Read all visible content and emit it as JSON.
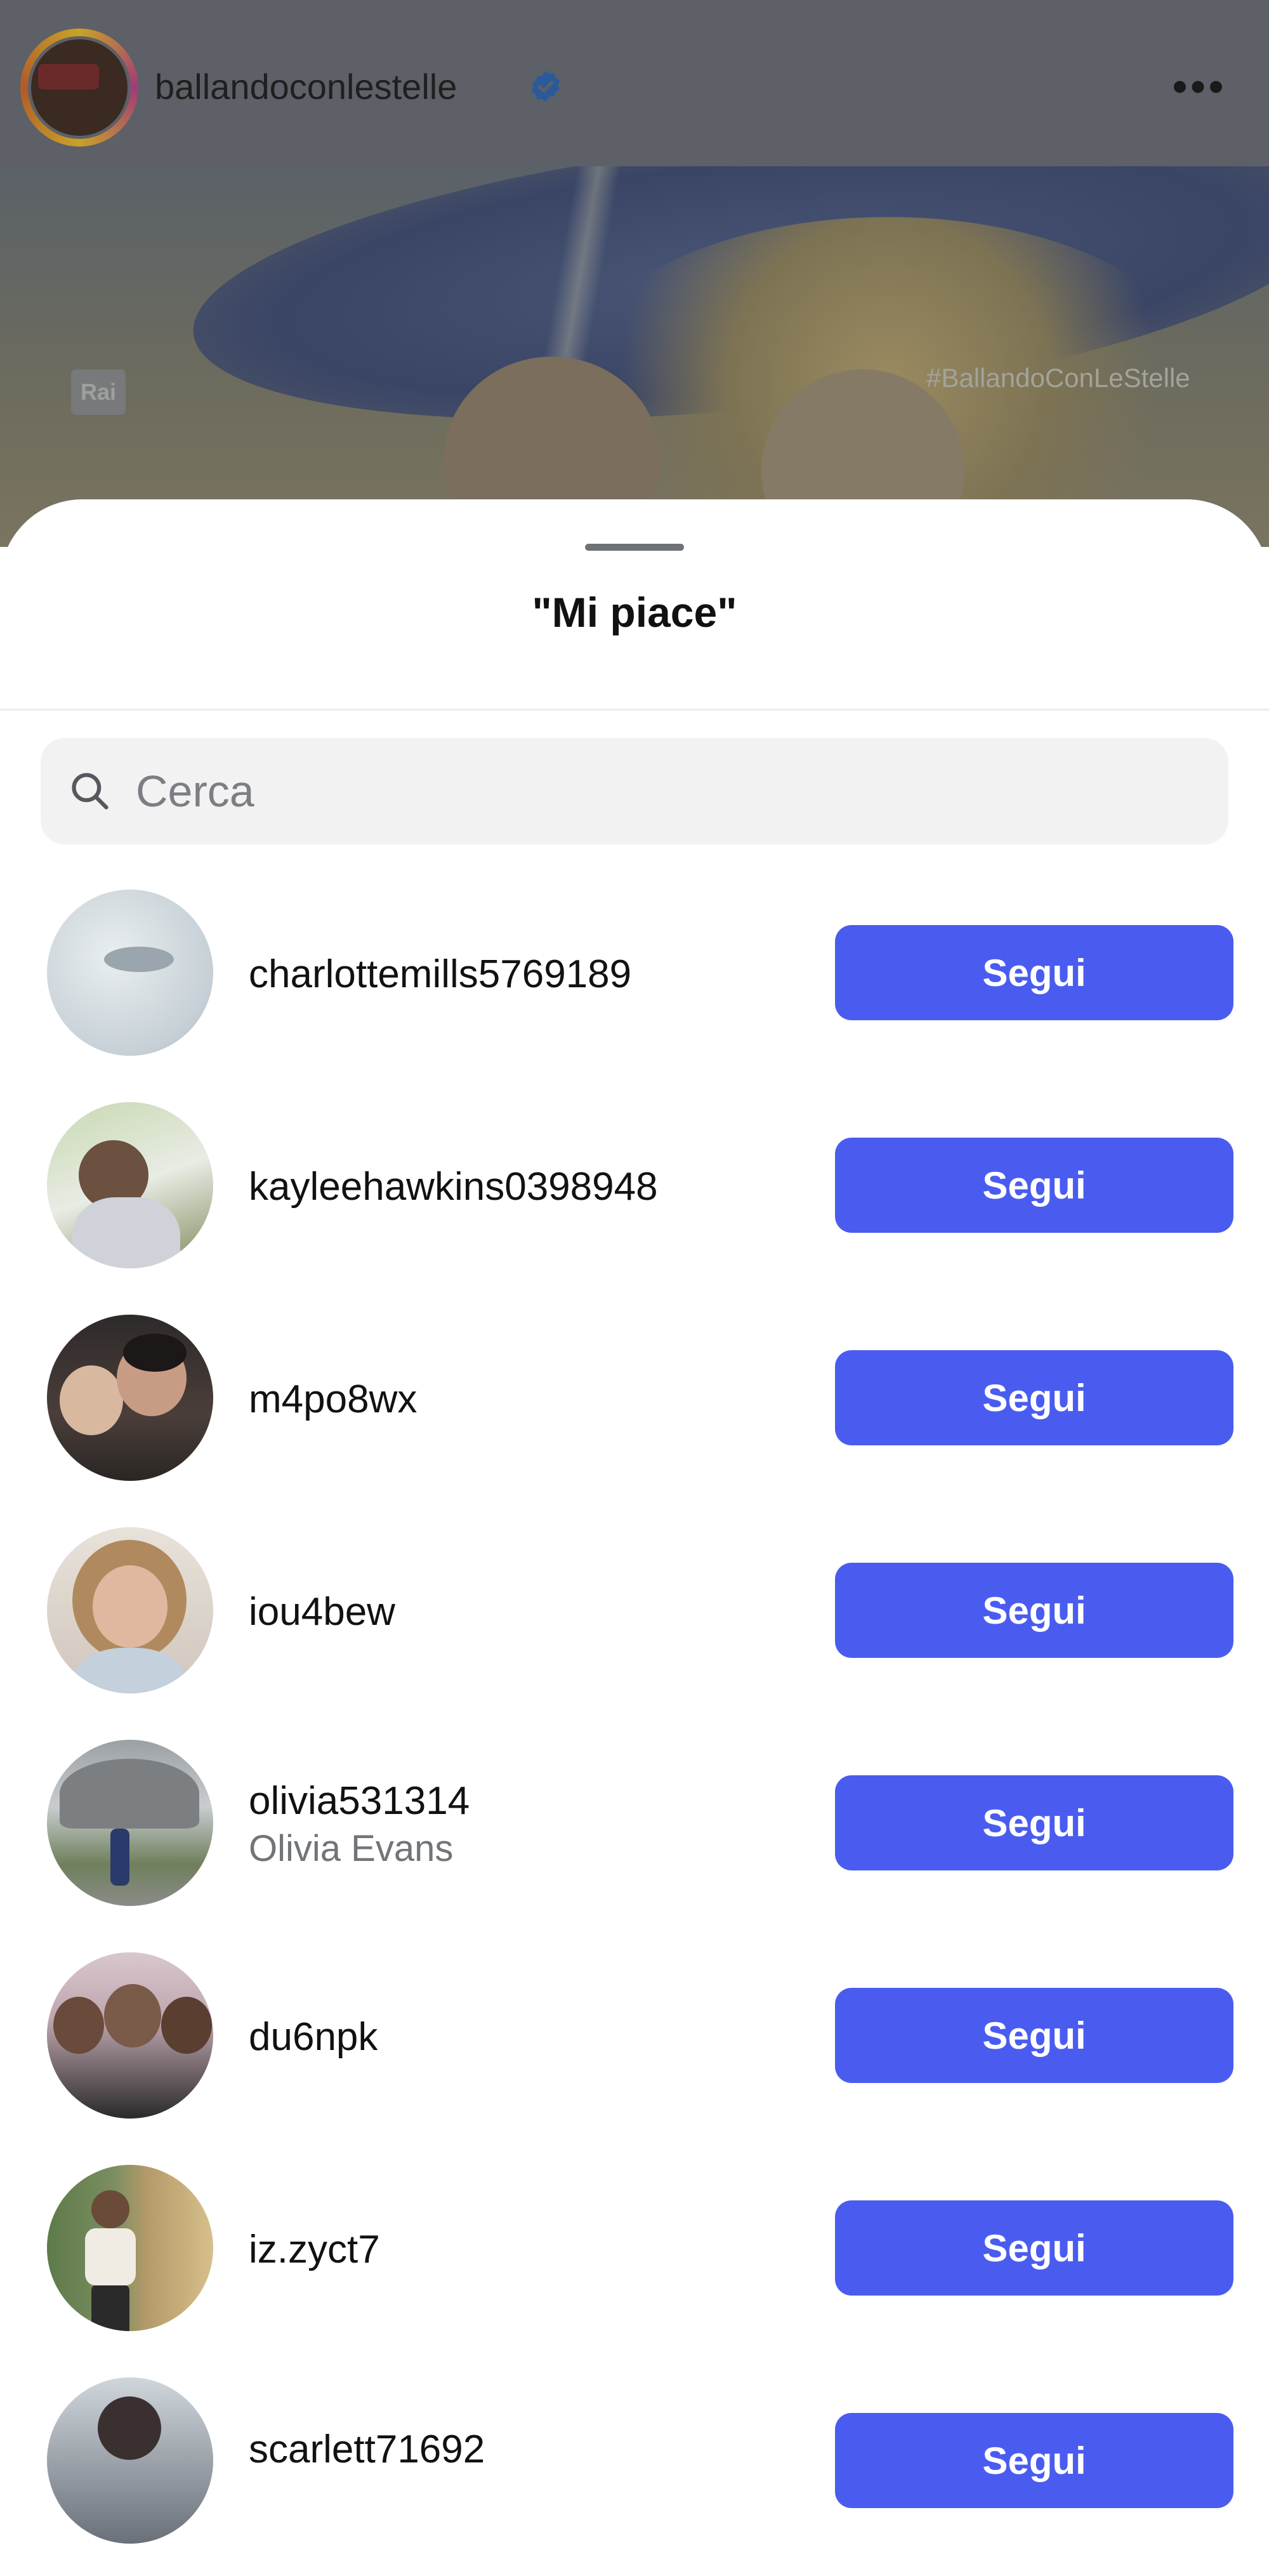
{
  "post": {
    "account_name": "ballandoconlestelle",
    "verified_icon": "verified-badge-icon",
    "more_icon": "more-horizontal-icon",
    "more_glyph": "•••",
    "media": {
      "channel_logo": "Rai",
      "hashtag": "#BallandoConLeStelle"
    }
  },
  "sheet": {
    "title": "\"Mi piace\"",
    "search": {
      "placeholder": "Cerca",
      "value": ""
    },
    "users": [
      {
        "handle": "charlottemills5769189",
        "full_name": "",
        "button": "Segui"
      },
      {
        "handle": "kayleehawkins0398948",
        "full_name": "",
        "button": "Segui"
      },
      {
        "handle": "m4po8wx",
        "full_name": "",
        "button": "Segui"
      },
      {
        "handle": "iou4bew",
        "full_name": "",
        "button": "Segui"
      },
      {
        "handle": "olivia531314",
        "full_name": "Olivia Evans",
        "button": "Segui"
      },
      {
        "handle": "du6npk",
        "full_name": "",
        "button": "Segui"
      },
      {
        "handle": "iz.zyct7",
        "full_name": "",
        "button": "Segui"
      },
      {
        "handle": "scarlett71692",
        "full_name": "",
        "button": "Segui"
      }
    ]
  },
  "colors": {
    "follow_button": "#4a5cf0",
    "verified": "#2f80ed"
  }
}
